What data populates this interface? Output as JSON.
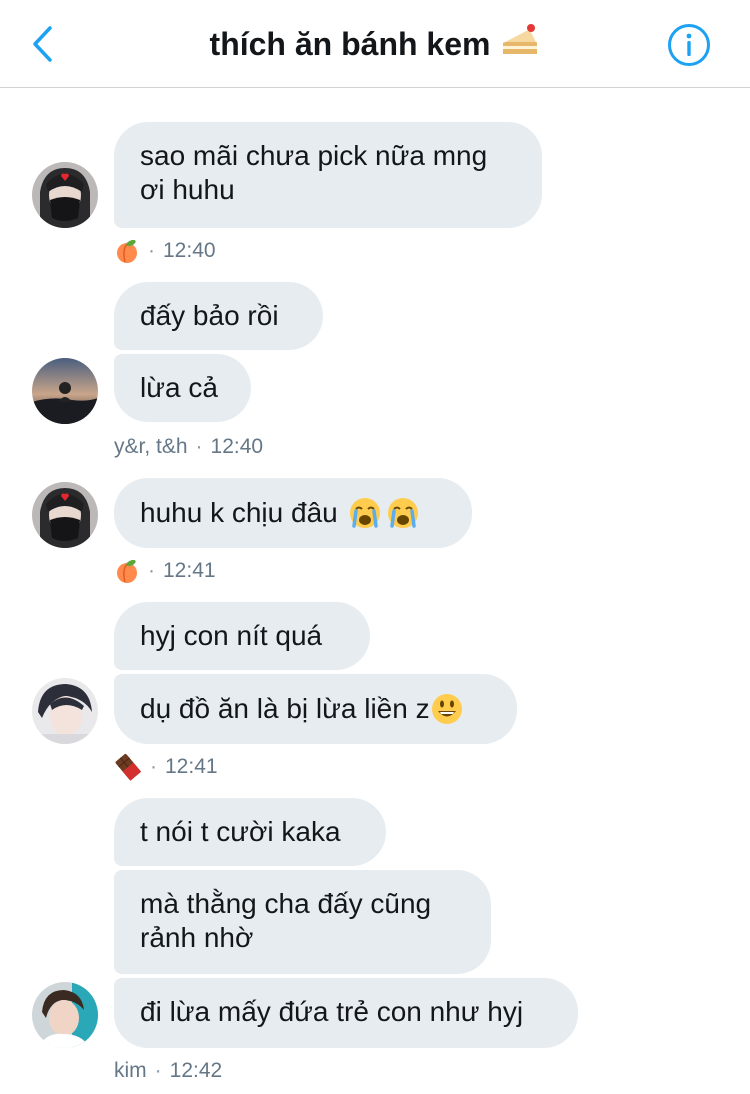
{
  "header": {
    "title": "thích ăn bánh kem",
    "title_emoji": "🍰"
  },
  "messages": [
    {
      "group": 1,
      "bubbles": [
        "sao mãi chưa pick nữa mng",
        "ơi huhu"
      ],
      "sender_label": "🍑",
      "time": "12:40"
    },
    {
      "group": 2,
      "bubbles": [
        "đấy bảo rồi",
        "lừa cả"
      ],
      "sender_label": "y&r, t&h",
      "time": "12:40"
    },
    {
      "group": 3,
      "bubbles": [
        "huhu k chịu đâu 😭😭"
      ],
      "sender_label": "🍑",
      "time": "12:41"
    },
    {
      "group": 4,
      "bubbles": [
        "hyj con nít quá",
        "dụ đồ ăn là bị lừa liền z😃"
      ],
      "sender_label": "🍫",
      "time": "12:41"
    },
    {
      "group": 5,
      "bubbles": [
        "t nói t cười kaka",
        "mà thằng cha đấy cũng",
        "rảnh nhờ",
        "đi lừa mấy đứa trẻ con như hyj"
      ],
      "sender_label": "kim",
      "time": "12:42"
    }
  ],
  "colors": {
    "accent": "#1da1f2",
    "bubble": "#e6ecf0",
    "meta_text": "#657786"
  }
}
